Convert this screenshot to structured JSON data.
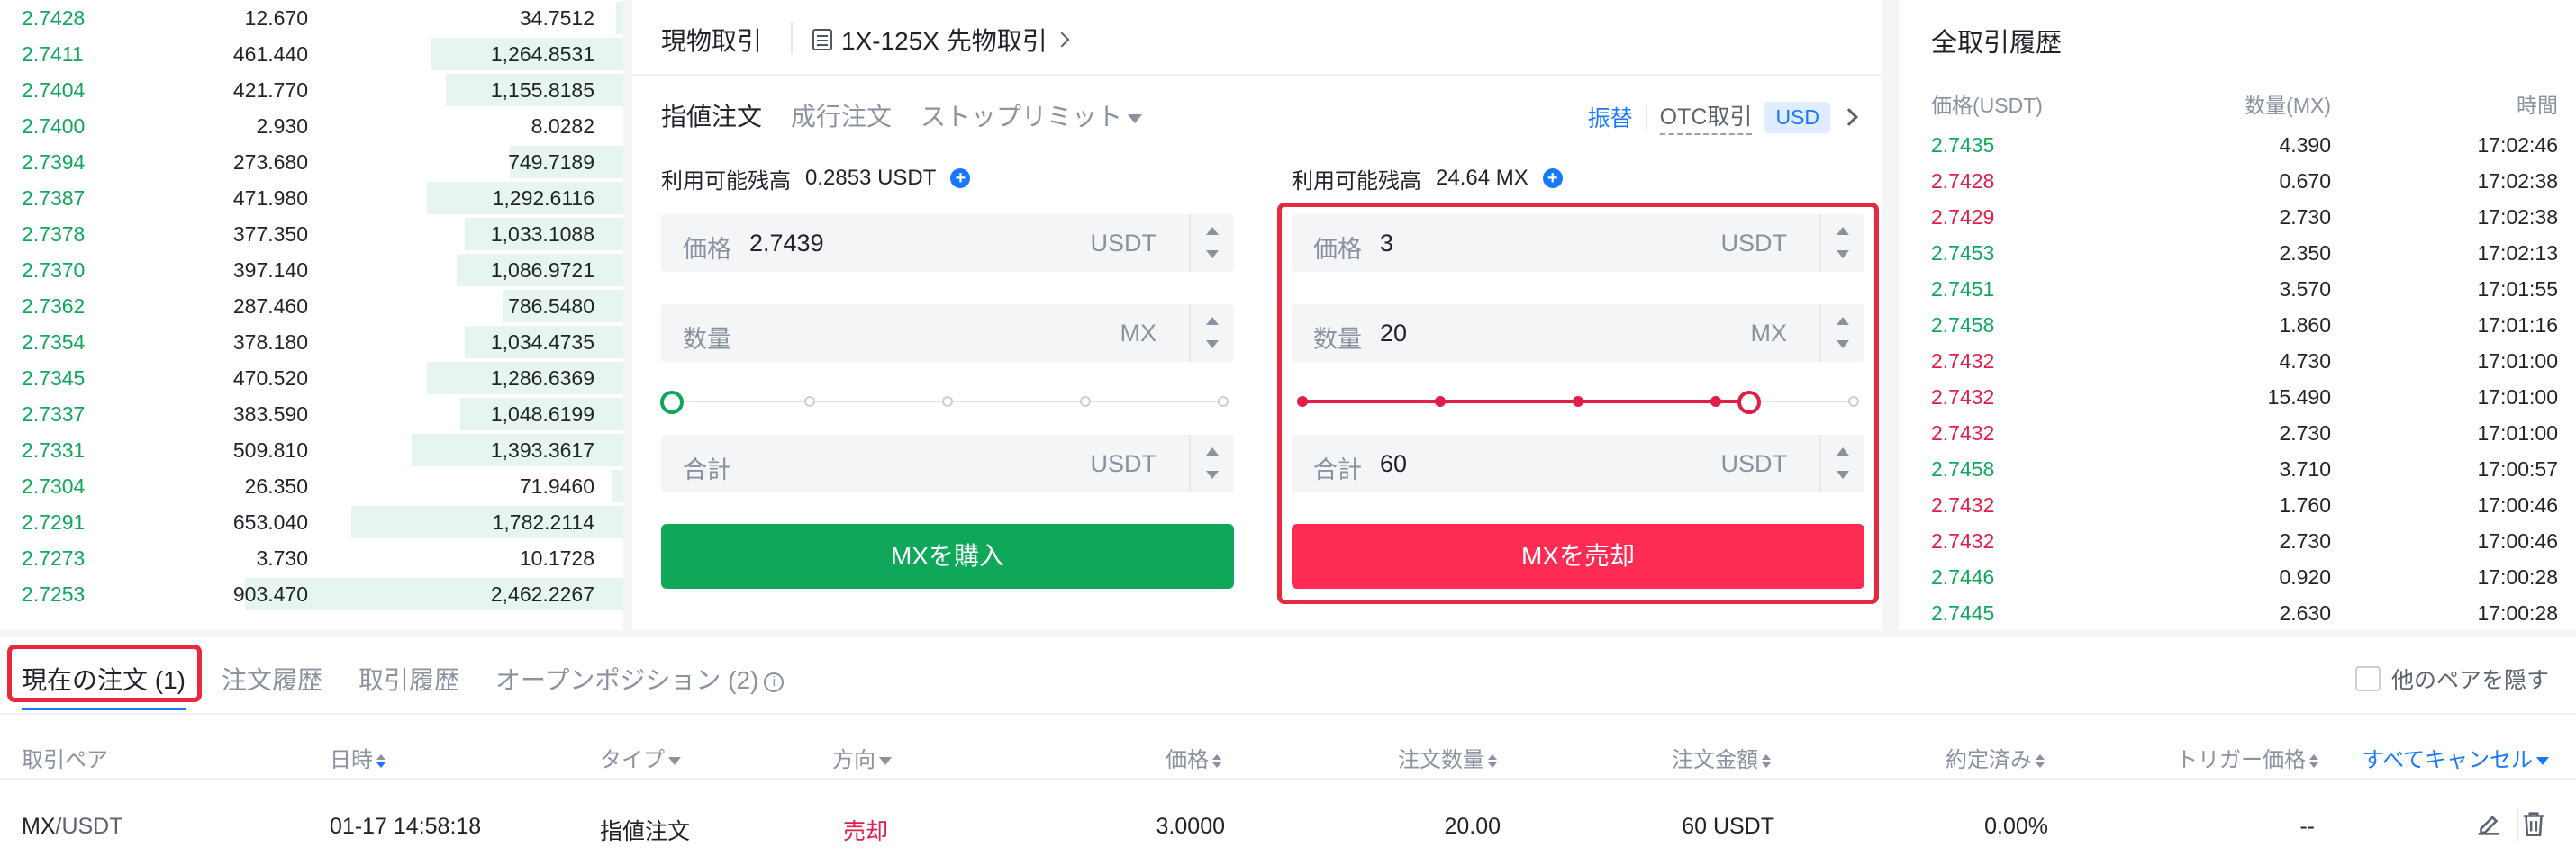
{
  "colors": {
    "buy": "#0fa85a",
    "sell": "#fe2c55",
    "accent": "#1677ff",
    "highlight_box": "#e8283f"
  },
  "orderbook": {
    "rows": [
      {
        "price": "2.7428",
        "qty": "12.670",
        "total": "34.7512",
        "depth": 0.02
      },
      {
        "price": "2.7411",
        "qty": "461.440",
        "total": "1,264.8531",
        "depth": 0.51
      },
      {
        "price": "2.7404",
        "qty": "421.770",
        "total": "1,155.8185",
        "depth": 0.47
      },
      {
        "price": "2.7400",
        "qty": "2.930",
        "total": "8.0282",
        "depth": 0.0
      },
      {
        "price": "2.7394",
        "qty": "273.680",
        "total": "749.7189",
        "depth": 0.3
      },
      {
        "price": "2.7387",
        "qty": "471.980",
        "total": "1,292.6116",
        "depth": 0.52
      },
      {
        "price": "2.7378",
        "qty": "377.350",
        "total": "1,033.1088",
        "depth": 0.42
      },
      {
        "price": "2.7370",
        "qty": "397.140",
        "total": "1,086.9721",
        "depth": 0.44
      },
      {
        "price": "2.7362",
        "qty": "287.460",
        "total": "786.5480",
        "depth": 0.32
      },
      {
        "price": "2.7354",
        "qty": "378.180",
        "total": "1,034.4735",
        "depth": 0.42
      },
      {
        "price": "2.7345",
        "qty": "470.520",
        "total": "1,286.6369",
        "depth": 0.52
      },
      {
        "price": "2.7337",
        "qty": "383.590",
        "total": "1,048.6199",
        "depth": 0.43
      },
      {
        "price": "2.7331",
        "qty": "509.810",
        "total": "1,393.3617",
        "depth": 0.56
      },
      {
        "price": "2.7304",
        "qty": "26.350",
        "total": "71.9460",
        "depth": 0.03
      },
      {
        "price": "2.7291",
        "qty": "653.040",
        "total": "1,782.2114",
        "depth": 0.72
      },
      {
        "price": "2.7273",
        "qty": "3.730",
        "total": "10.1728",
        "depth": 0.0
      },
      {
        "price": "2.7253",
        "qty": "903.470",
        "total": "2,462.2267",
        "depth": 1.0
      }
    ]
  },
  "trade": {
    "header": {
      "spot": "現物取引",
      "futures": "1X-125X 先物取引"
    },
    "order_types": {
      "limit": "指値注文",
      "market": "成行注文",
      "stop_limit": "ストップリミット"
    },
    "links": {
      "transfer": "振替",
      "otc": "OTC取引",
      "currency": "USD"
    },
    "buy": {
      "avail_label": "利用可能残高",
      "avail_value": "0.2853 USDT",
      "price_label": "価格",
      "price_value": "2.7439",
      "price_unit": "USDT",
      "qty_label": "数量",
      "qty_value": "",
      "qty_unit": "MX",
      "total_label": "合計",
      "total_value": "",
      "total_unit": "USDT",
      "slider_percent": 0,
      "button": "MXを購入"
    },
    "sell": {
      "avail_label": "利用可能残高",
      "avail_value": "24.64 MX",
      "price_label": "価格",
      "price_value": "3",
      "price_unit": "USDT",
      "qty_label": "数量",
      "qty_value": "20",
      "qty_unit": "MX",
      "total_label": "合計",
      "total_value": "60",
      "total_unit": "USDT",
      "slider_percent": 81,
      "button": "MXを売却"
    }
  },
  "history": {
    "title": "全取引履歴",
    "headers": {
      "price": "価格(USDT)",
      "qty": "数量(MX)",
      "time": "時間"
    },
    "rows": [
      {
        "price": "2.7435",
        "qty": "4.390",
        "time": "17:02:46",
        "side": "up"
      },
      {
        "price": "2.7428",
        "qty": "0.670",
        "time": "17:02:38",
        "side": "down"
      },
      {
        "price": "2.7429",
        "qty": "2.730",
        "time": "17:02:38",
        "side": "down"
      },
      {
        "price": "2.7453",
        "qty": "2.350",
        "time": "17:02:13",
        "side": "up"
      },
      {
        "price": "2.7451",
        "qty": "3.570",
        "time": "17:01:55",
        "side": "up"
      },
      {
        "price": "2.7458",
        "qty": "1.860",
        "time": "17:01:16",
        "side": "up"
      },
      {
        "price": "2.7432",
        "qty": "4.730",
        "time": "17:01:00",
        "side": "down"
      },
      {
        "price": "2.7432",
        "qty": "15.490",
        "time": "17:01:00",
        "side": "down"
      },
      {
        "price": "2.7432",
        "qty": "2.730",
        "time": "17:01:00",
        "side": "down"
      },
      {
        "price": "2.7458",
        "qty": "3.710",
        "time": "17:00:57",
        "side": "up"
      },
      {
        "price": "2.7432",
        "qty": "1.760",
        "time": "17:00:46",
        "side": "down"
      },
      {
        "price": "2.7432",
        "qty": "2.730",
        "time": "17:00:46",
        "side": "down"
      },
      {
        "price": "2.7446",
        "qty": "0.920",
        "time": "17:00:28",
        "side": "up"
      },
      {
        "price": "2.7445",
        "qty": "2.630",
        "time": "17:00:28",
        "side": "up"
      }
    ]
  },
  "bottom": {
    "tabs": {
      "current": "現在の注文 (1)",
      "order_history": "注文履歴",
      "trade_history": "取引履歴",
      "open_positions": "オープンポジション (2)"
    },
    "hide_pairs": "他のペアを隠す",
    "columns": {
      "pair": "取引ペア",
      "datetime": "日時",
      "type": "タイプ",
      "direction": "方向",
      "price": "価格",
      "qty": "注文数量",
      "amount": "注文金額",
      "filled": "約定済み",
      "trigger": "トリガー価格",
      "cancel_all": "すべてキャンセル"
    },
    "order": {
      "pair_base": "MX",
      "pair_quote": "/USDT",
      "datetime": "01-17 14:58:18",
      "type": "指値注文",
      "direction": "売却",
      "price": "3.0000",
      "qty": "20.00",
      "amount": "60",
      "amount_unit": "USDT",
      "filled": "0.00%",
      "trigger": "--"
    }
  }
}
